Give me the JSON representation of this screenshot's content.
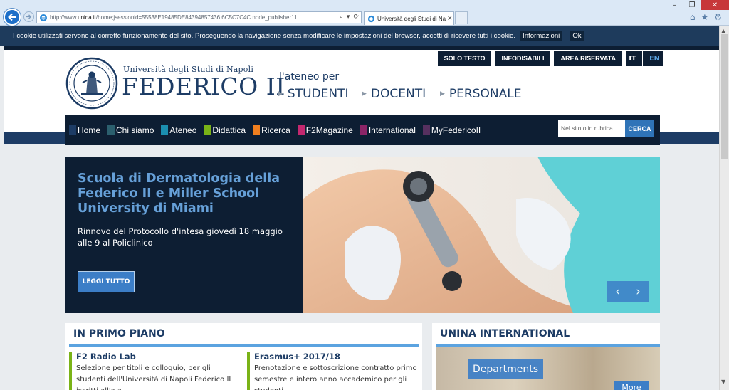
{
  "browser": {
    "url_prefix": "http://www.",
    "url_host": "unina.it",
    "url_rest": "/home;jsessionid=55538E19485DE84394857436 6C5C7C4C.node_publisher11",
    "tab_title": "Università degli Studi di Na...",
    "tab_close": "×",
    "addr_tools": [
      "⌕",
      "▾",
      "⟳"
    ],
    "toolbar_icons": [
      "⌂",
      "★",
      "⚙"
    ],
    "window_controls": [
      "–",
      "❐",
      "✕"
    ]
  },
  "cookie_bar": {
    "text": "I cookie utilizzati servono al corretto funzionamento del sito. Proseguendo la navigazione senza modificare le impostazioni del browser, accetti di ricevere tutti i cookie.",
    "info_label": "Informazioni",
    "ok_label": "Ok"
  },
  "header": {
    "top_links": [
      "SOLO TESTO",
      "INFODISABILI",
      "AREA RISERVATA"
    ],
    "lang_it": "IT",
    "lang_en": "EN",
    "uni_name_line1": "Università degli Studi di Napoli",
    "uni_name_line2": "FEDERICO II",
    "ateneo_per": "l'ateneo per",
    "audiences": [
      "STUDENTI",
      "DOCENTI",
      "PERSONALE"
    ]
  },
  "nav": {
    "items": [
      {
        "label": "Home",
        "color": "#1d3c65"
      },
      {
        "label": "Chi siamo",
        "color": "#2b5f6e"
      },
      {
        "label": "Ateneo",
        "color": "#1b8fb0"
      },
      {
        "label": "Didattica",
        "color": "#7ab317"
      },
      {
        "label": "Ricerca",
        "color": "#f07f1f"
      },
      {
        "label": "F2Magazine",
        "color": "#c3286f"
      },
      {
        "label": "International",
        "color": "#8c2567"
      },
      {
        "label": "MyFedericoII",
        "color": "#56305f"
      }
    ],
    "search_placeholder": "Nel sito o in rubrica",
    "search_button": "CERCA"
  },
  "hero": {
    "title": "Scuola di Dermatologia della Federico II e Miller School University di Miami",
    "text": "Rinnovo del Protocollo d'intesa giovedì 18 maggio alle 9 al Policlinico",
    "button": "LEGGI TUTTO",
    "prev": "‹",
    "next": "›"
  },
  "primo_piano": {
    "title": "IN PRIMO PIANO",
    "news": [
      {
        "title": "F2 Radio Lab",
        "text": "Selezione per titoli e colloquio, per gli studenti dell'Università di Napoli Federico II iscritti all'a.a.",
        "accent": "#7ab317"
      },
      {
        "title": "Erasmus+ 2017/18",
        "text": "Prenotazione e sottoscrizione contratto primo semestre e intero anno accademico per gli studenti",
        "accent": "#7ab317"
      }
    ]
  },
  "international": {
    "title": "UNINA INTERNATIONAL",
    "departments": "Departments",
    "more": "More"
  },
  "colors": {
    "navy": "#0d1e33",
    "brand_blue": "#1d3c65",
    "accent_blue": "#3c7ec7"
  }
}
